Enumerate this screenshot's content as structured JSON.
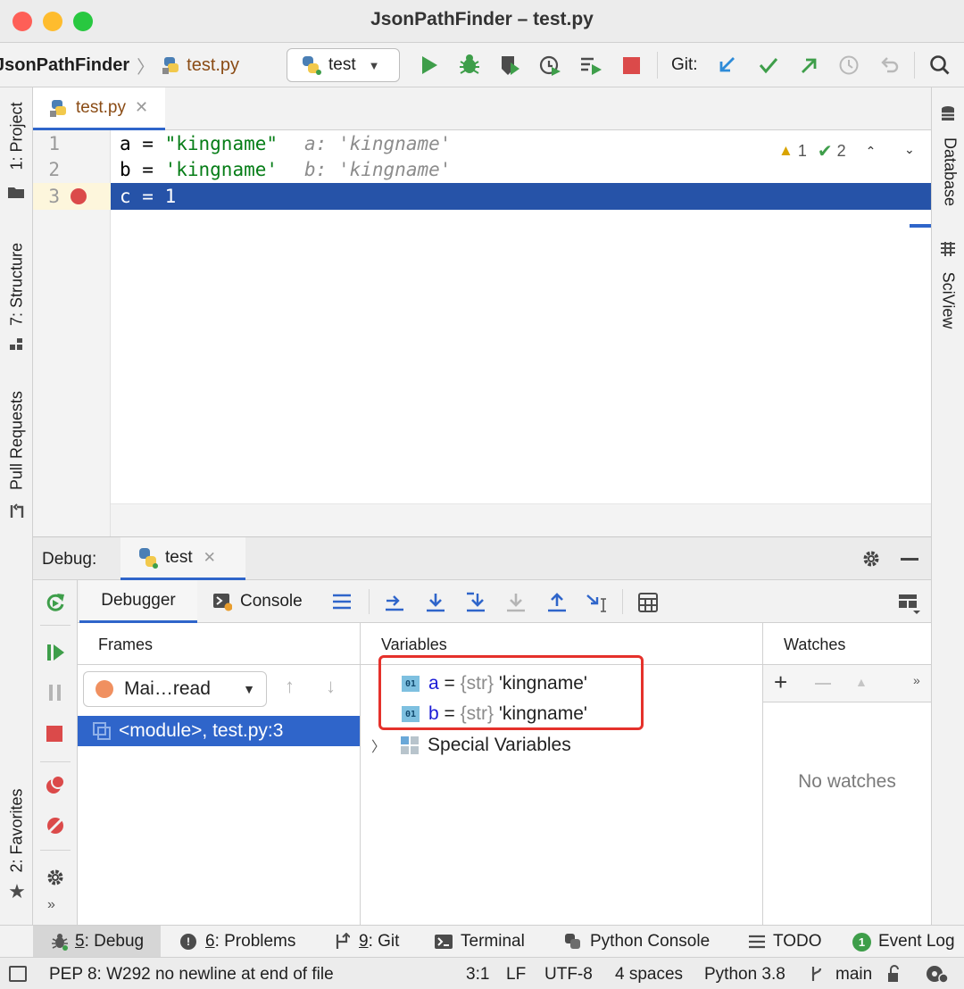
{
  "window": {
    "title": "JsonPathFinder – test.py"
  },
  "toolbar": {
    "project": "JsonPathFinder",
    "file": "test.py",
    "run_config": "test",
    "git_label": "Git:"
  },
  "left_strip": {
    "project": "1: Project",
    "structure": "7: Structure",
    "pull_requests": "Pull Requests",
    "favorites": "2: Favorites"
  },
  "right_strip": {
    "database": "Database",
    "sciview": "SciView"
  },
  "editor": {
    "tab": "test.py",
    "inspections": {
      "warnings": "1",
      "ok": "2"
    },
    "lines": [
      {
        "num": "1",
        "code": [
          "a",
          " = ",
          "\"kingname\""
        ],
        "hint": "a: 'kingname'"
      },
      {
        "num": "2",
        "code": [
          "b",
          " = ",
          "'kingname'"
        ],
        "hint": "b: 'kingname'"
      },
      {
        "num": "3",
        "code": [
          "c",
          " = ",
          "1"
        ],
        "hint": ""
      }
    ]
  },
  "debug": {
    "label": "Debug:",
    "session": "test",
    "tabs": {
      "debugger": "Debugger",
      "console": "Console"
    },
    "frames": {
      "header": "Frames",
      "thread": "Mai…read",
      "frame": "<module>, test.py:3"
    },
    "variables": {
      "header": "Variables",
      "items": [
        {
          "name": "a",
          "eq": " = ",
          "type": "{str}",
          "value": " 'kingname'"
        },
        {
          "name": "b",
          "eq": " = ",
          "type": "{str}",
          "value": " 'kingname'"
        }
      ],
      "special": "Special Variables"
    },
    "watches": {
      "header": "Watches",
      "empty": "No watches"
    }
  },
  "bottom_tabs": {
    "debug": {
      "num": "5",
      "rest": ": Debug"
    },
    "problems": {
      "num": "6",
      "rest": ": Problems"
    },
    "git": {
      "num": "9",
      "rest": ": Git"
    },
    "terminal": "Terminal",
    "python_console": "Python Console",
    "todo": "TODO",
    "event_log": "Event Log",
    "event_count": "1"
  },
  "status": {
    "message": "PEP 8: W292 no newline at end of file",
    "position": "3:1",
    "line_sep": "LF",
    "encoding": "UTF-8",
    "indent": "4 spaces",
    "interpreter": "Python 3.8",
    "branch": "main"
  },
  "colors": {
    "accent": "#2f65ca",
    "selection": "#2653a8",
    "run": "#3e9e4a",
    "stop": "#db4a4a",
    "highlight_box": "#e5312b"
  }
}
